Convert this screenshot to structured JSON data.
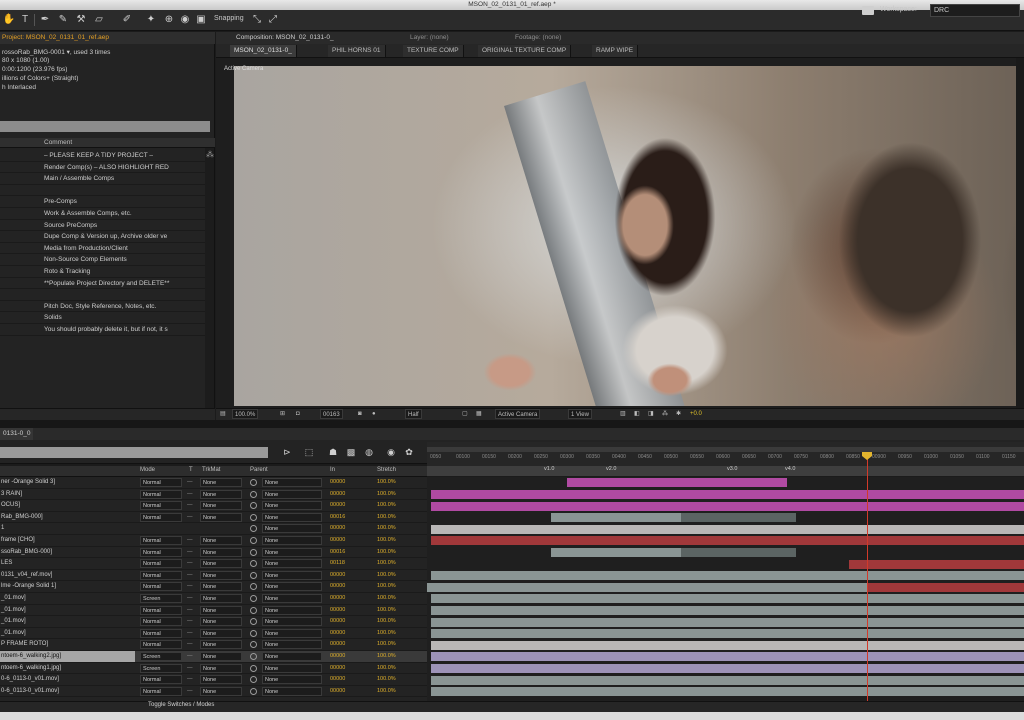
{
  "window": {
    "title": "MSON_02_0131_01_ref.aep *"
  },
  "toolbar": {
    "tools": [
      "hand-tool",
      "zoom-tool",
      "text-tool",
      "pen-tool",
      "brush-tool",
      "clone-stamp-tool",
      "eraser-tool",
      "roto-brush-tool",
      "puppet-pin-tool"
    ],
    "snapping_label": "Snapping",
    "workspace_label": "Workspace:",
    "workspace_value": "DRC"
  },
  "project": {
    "tab_label": "Project: MSON_02_0131_01_ref.aep",
    "info_lines": [
      "rossoRab_BMG-0001 ▾, used 3 times",
      "80 x 1080 (1.00)",
      "0:00:1200 (23.976 fps)",
      "illions of Colors+ (Straight)",
      "h Interlaced"
    ],
    "comment_header": "Comment",
    "rows": [
      {
        "label": "",
        "comment": "– PLEASE KEEP A TIDY PROJECT –"
      },
      {
        "label": "",
        "comment": "Render Comp(s) – ALSO HIGHLIGHT RED"
      },
      {
        "label": "",
        "comment": "Main / Assemble Comps"
      },
      {
        "label": "",
        "comment": ""
      },
      {
        "label": "",
        "comment": "Pre-Comps"
      },
      {
        "label": "",
        "comment": "Work & Assemble Comps, etc."
      },
      {
        "label": "",
        "comment": "Source PreComps"
      },
      {
        "label": "",
        "comment": "Dupe Comp & Version up, Archive older ve"
      },
      {
        "label": "",
        "comment": "Media from Production/Client"
      },
      {
        "label": "",
        "comment": "Non-Source Comp Elements"
      },
      {
        "label": "",
        "comment": "Roto & Tracking"
      },
      {
        "label": "",
        "comment": "**Populate Project Directory and DELETE**"
      },
      {
        "label": "",
        "comment": ""
      },
      {
        "label": "",
        "comment": "Pitch Doc, Style Reference, Notes, etc."
      },
      {
        "label": "",
        "comment": "Solids"
      },
      {
        "label": "",
        "comment": "You should probably delete it, but if not, it s"
      }
    ]
  },
  "composition": {
    "panel_title": "Composition: MSON_02_0131-0_",
    "layer_label": "Layer: (none)",
    "footage_label": "Footage: (none)",
    "tabs": [
      "MSON_02_0131-0_",
      "PHIL HORNS 01",
      "TEXTURE COMP",
      "ORIGINAL TEXTURE COMP",
      "RAMP WIPE"
    ],
    "viewer_label": "Active Camera",
    "footer": {
      "magnification": "100.0%",
      "timecode": "00163",
      "resolution": "Half",
      "view": "Active Camera",
      "views": "1 View",
      "exposure": "+0.0"
    }
  },
  "timeline": {
    "tab_label": "0131-0_0",
    "column_headers": [
      "Mode",
      "T",
      "TrkMat",
      "Parent",
      "In",
      "Stretch"
    ],
    "ruler_ticks": [
      "0050",
      "00100",
      "00150",
      "00200",
      "00250",
      "00300",
      "00350",
      "00400",
      "00450",
      "00500",
      "00550",
      "00600",
      "00650",
      "00700",
      "00750",
      "00800",
      "00850",
      "00900",
      "00950",
      "01000",
      "01050",
      "01100",
      "01150"
    ],
    "markers": [
      "v1.0",
      "v2.0",
      "v3.0",
      "v4.0"
    ],
    "layers": [
      {
        "name": "ner -Orange Solid 3]",
        "mode": "Normal",
        "trkmat": "None",
        "parent": "None",
        "in": "00000",
        "stretch": "100.0%",
        "selected": false
      },
      {
        "name": "3 RAIN]",
        "mode": "Normal",
        "trkmat": "None",
        "parent": "None",
        "in": "00000",
        "stretch": "100.0%",
        "selected": false
      },
      {
        "name": "OCUS]",
        "mode": "Normal",
        "trkmat": "None",
        "parent": "None",
        "in": "00000",
        "stretch": "100.0%",
        "selected": false
      },
      {
        "name": "Rab_BMG-000]",
        "mode": "Normal",
        "trkmat": "None",
        "parent": "None",
        "in": "00016",
        "stretch": "100.0%",
        "selected": false
      },
      {
        "name": "1",
        "mode": "",
        "trkmat": "",
        "parent": "None",
        "in": "00000",
        "stretch": "100.0%",
        "selected": false
      },
      {
        "name": "frame [CHO]",
        "mode": "Normal",
        "trkmat": "None",
        "parent": "None",
        "in": "00000",
        "stretch": "100.0%",
        "selected": false
      },
      {
        "name": "ssoRab_BMG-000]",
        "mode": "Normal",
        "trkmat": "None",
        "parent": "None",
        "in": "00016",
        "stretch": "100.0%",
        "selected": false
      },
      {
        "name": "LES",
        "mode": "Normal",
        "trkmat": "None",
        "parent": "None",
        "in": "00118",
        "stretch": "100.0%",
        "selected": false
      },
      {
        "name": "0131_v04_ref.mov]",
        "mode": "Normal",
        "trkmat": "None",
        "parent": "None",
        "in": "00000",
        "stretch": "100.0%",
        "selected": false
      },
      {
        "name": "lme -Orange Solid 1]",
        "mode": "Normal",
        "trkmat": "None",
        "parent": "None",
        "in": "00000",
        "stretch": "100.0%",
        "selected": false
      },
      {
        "name": "_01.mov]",
        "mode": "Screen",
        "trkmat": "None",
        "parent": "None",
        "in": "00000",
        "stretch": "100.0%",
        "selected": false
      },
      {
        "name": "_01.mov]",
        "mode": "Normal",
        "trkmat": "None",
        "parent": "None",
        "in": "00000",
        "stretch": "100.0%",
        "selected": false
      },
      {
        "name": "_01.mov]",
        "mode": "Normal",
        "trkmat": "None",
        "parent": "None",
        "in": "00000",
        "stretch": "100.0%",
        "selected": false
      },
      {
        "name": "_01.mov]",
        "mode": "Normal",
        "trkmat": "None",
        "parent": "None",
        "in": "00000",
        "stretch": "100.0%",
        "selected": false
      },
      {
        "name": "P FRAME ROTO]",
        "mode": "Normal",
        "trkmat": "None",
        "parent": "None",
        "in": "00000",
        "stretch": "100.0%",
        "selected": false
      },
      {
        "name": "ntoem-6_walking2.jpg]",
        "mode": "Screen",
        "trkmat": "None",
        "parent": "None",
        "in": "00000",
        "stretch": "100.0%",
        "selected": true
      },
      {
        "name": "ntoem-6_walking1.jpg]",
        "mode": "Screen",
        "trkmat": "None",
        "parent": "None",
        "in": "00000",
        "stretch": "100.0%",
        "selected": false
      },
      {
        "name": "0-6_0113-0_v01.mov]",
        "mode": "Normal",
        "trkmat": "None",
        "parent": "None",
        "in": "00000",
        "stretch": "100.0%",
        "selected": false
      },
      {
        "name": "0-6_0113-0_v01.mov]",
        "mode": "Normal",
        "trkmat": "None",
        "parent": "None",
        "in": "00000",
        "stretch": "100.0%",
        "selected": false
      }
    ],
    "toggle_label": "Toggle Switches / Modes"
  },
  "colors": {
    "accent": "#e6a126",
    "playhead": "#d23a2a",
    "bar_pink": "#b04aa2",
    "bar_gray": "#8a9594",
    "bar_red": "#a1383a",
    "bar_lavender": "#9d93b8"
  }
}
